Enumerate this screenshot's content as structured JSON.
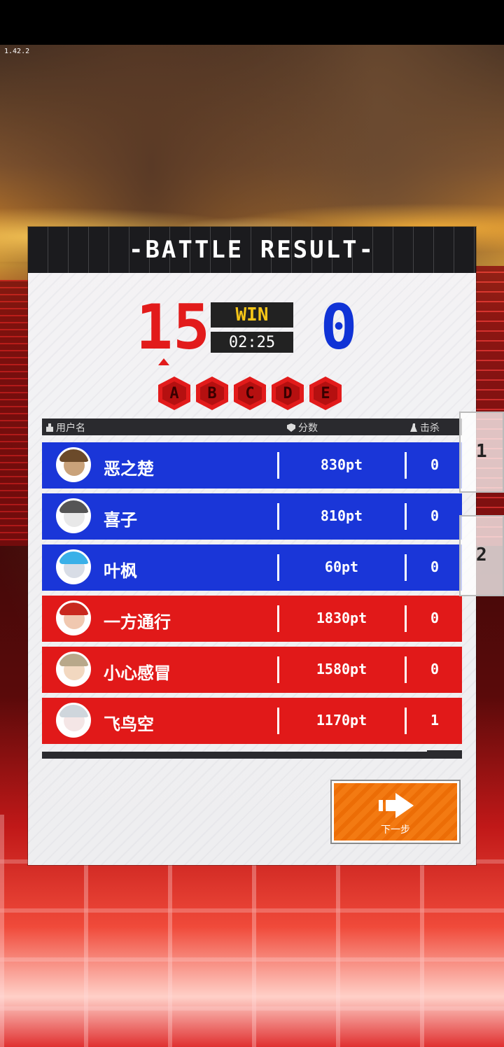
{
  "version": "1.42.2",
  "panel": {
    "title": "-BATTLE RESULT-"
  },
  "match": {
    "red_score": "15",
    "blue_score": "0",
    "result": "WIN",
    "time": "02:25"
  },
  "zones": [
    "A",
    "B",
    "C",
    "D",
    "E"
  ],
  "columns": {
    "user": "用户名",
    "score": "分数",
    "kills": "击杀"
  },
  "players": [
    {
      "name": "恶之楚",
      "points": "830pt",
      "kills": "0",
      "team": "blue"
    },
    {
      "name": "喜子",
      "points": "810pt",
      "kills": "0",
      "team": "blue"
    },
    {
      "name": "叶枫",
      "points": "60pt",
      "kills": "0",
      "team": "blue"
    },
    {
      "name": "一方通行",
      "points": "1830pt",
      "kills": "0",
      "team": "red"
    },
    {
      "name": "小心感冒",
      "points": "1580pt",
      "kills": "0",
      "team": "red"
    },
    {
      "name": "飞鸟空",
      "points": "1170pt",
      "kills": "1",
      "team": "red"
    }
  ],
  "next_button": {
    "label": "下一步"
  },
  "side_tabs": [
    "1",
    "2"
  ],
  "colors": {
    "team_blue": "#1a36d8",
    "team_red": "#e11919",
    "win_text": "#f5c518",
    "button": "#f37a12"
  }
}
